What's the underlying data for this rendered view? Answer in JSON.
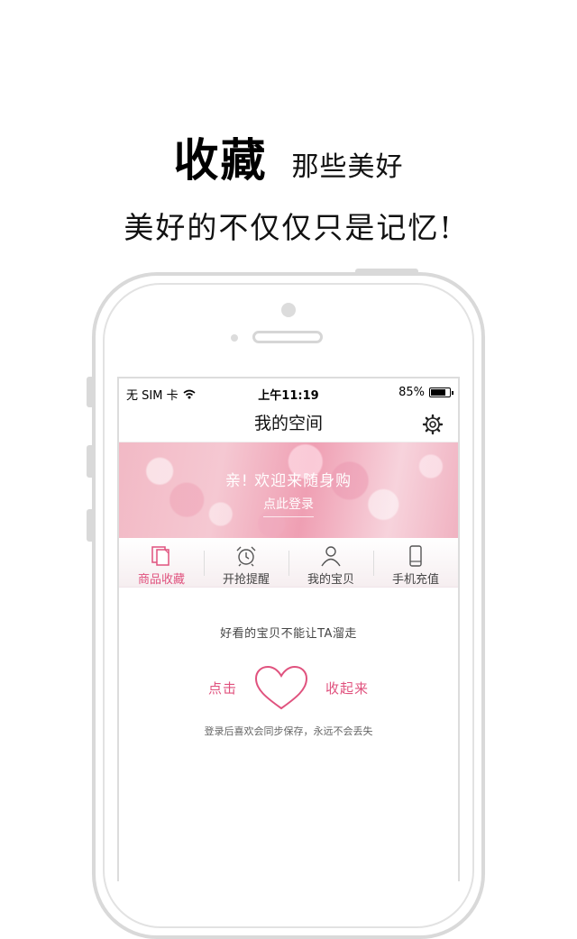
{
  "promo": {
    "title_main": "收藏",
    "title_sub": "那些美好",
    "tagline": "美好的不仅仅只是记忆!"
  },
  "status_bar": {
    "carrier": "无 SIM 卡",
    "time": "上午11:19",
    "battery_text": "85%",
    "battery_level": 0.85
  },
  "nav": {
    "title": "我的空间",
    "settings_icon": "gear-icon"
  },
  "banner": {
    "greeting": "亲!  欢迎来随身购",
    "login_link": "点此登录"
  },
  "tabs": [
    {
      "label": "商品收藏",
      "icon": "documents-icon",
      "active": true
    },
    {
      "label": "开抢提醒",
      "icon": "alarm-clock-icon",
      "active": false
    },
    {
      "label": "我的宝贝",
      "icon": "person-icon",
      "active": false
    },
    {
      "label": "手机充值",
      "icon": "phone-icon",
      "active": false
    }
  ],
  "empty_state": {
    "hint": "好看的宝贝不能让TA溜走",
    "left_text": "点击",
    "right_text": "收起来",
    "note": "登录后喜欢会同步保存，永远不会丢失"
  },
  "colors": {
    "accent": "#e0527e",
    "frame": "#d9d9d9"
  }
}
